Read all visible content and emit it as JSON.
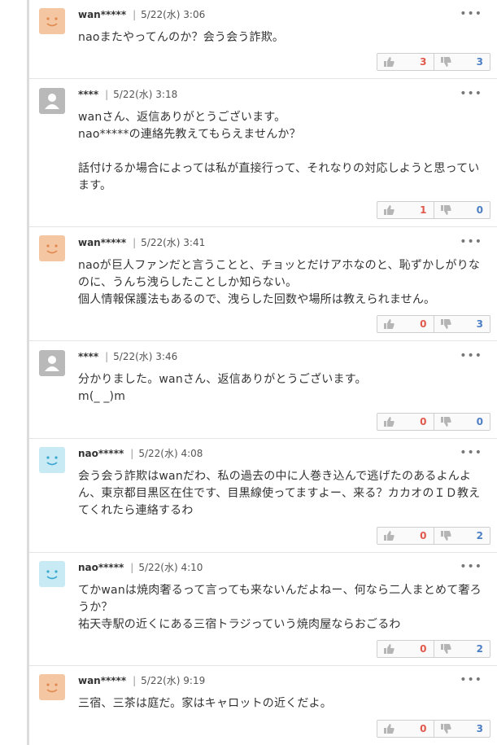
{
  "comments": [
    {
      "user": "wan*****",
      "date": "5/22(水) 3:06",
      "text": "naoまたやってんのか？会う会う詐欺。",
      "likes": "3",
      "dislikes": "3"
    },
    {
      "user": "****",
      "date": "5/22(水) 3:18",
      "text": "wanさん、返信ありがとうございます。\nnao*****の連絡先教えてもらえませんか？\n\n話付けるか場合によっては私が直接行って、それなりの対応しようと思っています。",
      "likes": "1",
      "dislikes": "0"
    },
    {
      "user": "wan*****",
      "date": "5/22(水) 3:41",
      "text": "naoが巨人ファンだと言うことと、チョッとだけアホなのと、恥ずかしがりなのに、うんち洩らしたことしか知らない。\n個人情報保護法もあるので、洩らした回数や場所は教えられません。",
      "likes": "0",
      "dislikes": "3"
    },
    {
      "user": "****",
      "date": "5/22(水) 3:46",
      "text": "分かりました。wanさん、返信ありがとうございます。\nm(_ _)m",
      "likes": "0",
      "dislikes": "0"
    },
    {
      "user": "nao*****",
      "date": "5/22(水) 4:08",
      "text": "会う会う詐欺はwanだわ、私の過去の中に人巻き込んで逃げたのあるよんよん、東京都目黒区在住です、目黒線使ってますよー、来る？カカオのＩＤ教えてくれたら連絡するわ",
      "likes": "0",
      "dislikes": "2"
    },
    {
      "user": "nao*****",
      "date": "5/22(水) 4:10",
      "text": "てかwanは焼肉奢るって言っても来ないんだよねー、何なら二人まとめて奢ろうか？\n祐天寺駅の近くにある三宿トラジっていう焼肉屋ならおごるわ",
      "likes": "0",
      "dislikes": "2"
    },
    {
      "user": "wan*****",
      "date": "5/22(水) 9:19",
      "text": "三宿、三茶は庭だ。家はキャロットの近くだよ。",
      "likes": "0",
      "dislikes": "3"
    }
  ],
  "icons": {
    "menu": "more-dots-icon",
    "like": "thumbs-up-icon",
    "dislike": "thumbs-down-icon"
  },
  "colors": {
    "like": "#e0594d",
    "dislike": "#4d7fc4",
    "avatar_orange": "#f4c6a2",
    "avatar_blue": "#c7eaf5",
    "avatar_grey": "#b9b9b9"
  }
}
